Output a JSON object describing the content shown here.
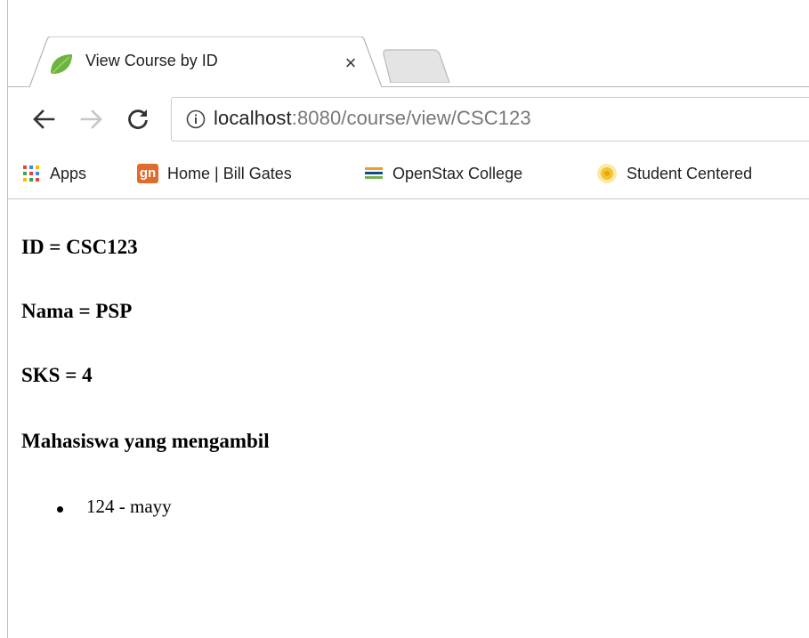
{
  "browser": {
    "active_tab": {
      "title": "View Course by ID",
      "close_glyph": "×",
      "favicon": "spring-leaf-icon",
      "favicon_color": "#6db33f"
    },
    "nav": {
      "back_icon": "back-arrow-icon",
      "forward_icon": "forward-arrow-icon",
      "reload_icon": "reload-icon"
    },
    "address": {
      "host": "localhost",
      "rest": ":8080/course/view/CSC123"
    },
    "bookmarks": [
      {
        "label": "Apps",
        "icon": "apps-grid-icon"
      },
      {
        "label": "Home | Bill Gates",
        "icon": "gn-icon",
        "icon_text": "gn",
        "icon_color": "#e06b2c"
      },
      {
        "label": "OpenStax College",
        "icon": "openstax-books-icon"
      },
      {
        "label": "Student Centered",
        "icon": "student-centered-icon"
      }
    ]
  },
  "page": {
    "id_line": "ID = CSC123",
    "nama_line": "Nama = PSP",
    "sks_line": "SKS = 4",
    "students_heading": "Mahasiswa yang mengambil",
    "students": [
      "124 - mayy"
    ]
  }
}
